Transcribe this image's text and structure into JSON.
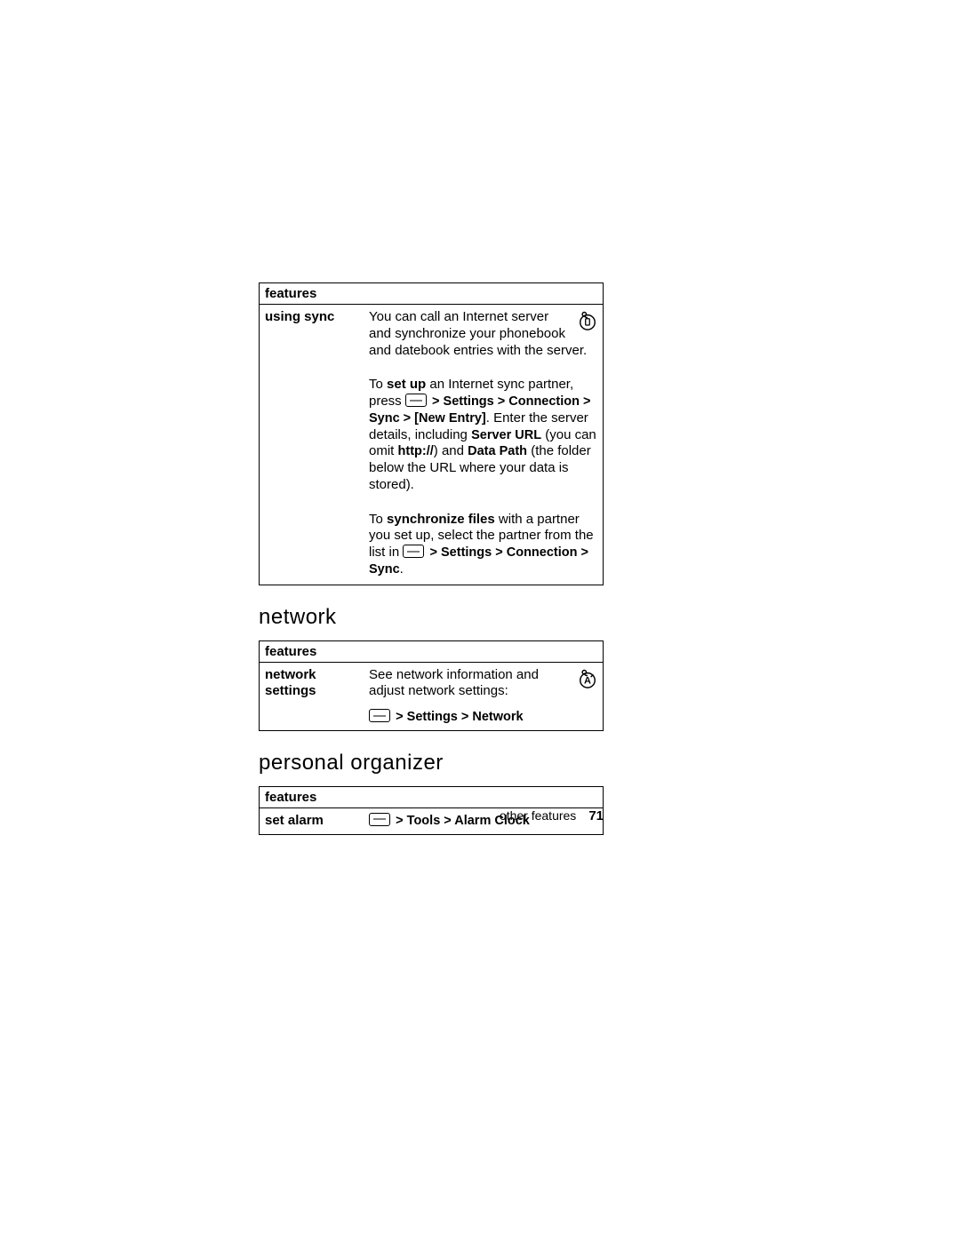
{
  "tables": {
    "t1": {
      "header": "features",
      "label": "using sync",
      "p1": {
        "text": "You can call an Internet server and synchronize your phonebook and datebook entries with the server."
      },
      "p2": {
        "pre": "To ",
        "b1": "set up",
        "mid1": " an Internet sync partner, press ",
        "path": "> Settings > Connection > Sync > [New Entry]",
        "after_path": ". Enter the server details, including ",
        "server": "Server URL",
        "mid2": " (you can omit ",
        "http": "http://",
        "mid3": ") and ",
        "dp": "Data Path",
        "tail": " (the folder below the URL where your data is stored)."
      },
      "p3": {
        "pre": "To ",
        "b1": "synchronize files",
        "mid": " with a partner you set up, select the partner from the list in ",
        "path": "> Settings > Connection > Sync",
        "tail": "."
      }
    },
    "h2a": "network",
    "t2": {
      "header": "features",
      "label": "network settings",
      "desc": "See network information and adjust network settings:",
      "path": "> Settings > Network"
    },
    "h2b": "personal organizer",
    "t3": {
      "header": "features",
      "label": "set alarm",
      "path": "> Tools > Alarm Clock"
    }
  },
  "footer": {
    "label": "other features",
    "page": "71"
  }
}
